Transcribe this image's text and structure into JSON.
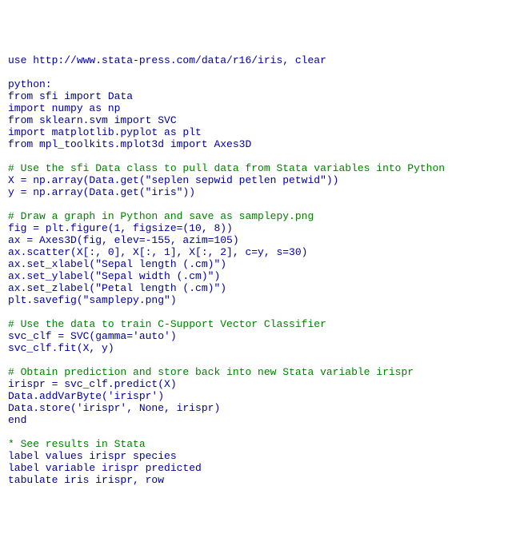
{
  "lines": [
    {
      "text": "use http://www.stata-press.com/data/r16/iris, clear",
      "class": "stata-cmd"
    },
    {
      "text": "",
      "class": ""
    },
    {
      "text": "python:",
      "class": "stata-cmd"
    },
    {
      "text": "from sfi import Data",
      "class": "python-code"
    },
    {
      "text": "import numpy as np",
      "class": "python-code"
    },
    {
      "text": "from sklearn.svm import SVC",
      "class": "python-code"
    },
    {
      "text": "import matplotlib.pyplot as plt",
      "class": "python-code"
    },
    {
      "text": "from mpl_toolkits.mplot3d import Axes3D",
      "class": "python-code"
    },
    {
      "text": "",
      "class": ""
    },
    {
      "text": "# Use the sfi Data class to pull data from Stata variables into Python",
      "class": "comment"
    },
    {
      "text": "X = np.array(Data.get(\"seplen sepwid petlen petwid\"))",
      "class": "python-code"
    },
    {
      "text": "y = np.array(Data.get(\"iris\"))",
      "class": "python-code"
    },
    {
      "text": "",
      "class": ""
    },
    {
      "text": "# Draw a graph in Python and save as samplepy.png",
      "class": "comment"
    },
    {
      "text": "fig = plt.figure(1, figsize=(10, 8))",
      "class": "python-code"
    },
    {
      "text": "ax = Axes3D(fig, elev=-155, azim=105)",
      "class": "python-code"
    },
    {
      "text": "ax.scatter(X[:, 0], X[:, 1], X[:, 2], c=y, s=30)",
      "class": "python-code"
    },
    {
      "text": "ax.set_xlabel(\"Sepal length (.cm)\")",
      "class": "python-code"
    },
    {
      "text": "ax.set_ylabel(\"Sepal width (.cm)\")",
      "class": "python-code"
    },
    {
      "text": "ax.set_zlabel(\"Petal length (.cm)\")",
      "class": "python-code"
    },
    {
      "text": "plt.savefig(\"samplepy.png\")",
      "class": "python-code"
    },
    {
      "text": "",
      "class": ""
    },
    {
      "text": "# Use the data to train C-Support Vector Classifier",
      "class": "comment"
    },
    {
      "text": "svc_clf = SVC(gamma='auto')",
      "class": "python-code"
    },
    {
      "text": "svc_clf.fit(X, y)",
      "class": "python-code"
    },
    {
      "text": "",
      "class": ""
    },
    {
      "text": "# Obtain prediction and store back into new Stata variable irispr",
      "class": "comment"
    },
    {
      "text": "irispr = svc_clf.predict(X)",
      "class": "python-code"
    },
    {
      "text": "Data.addVarByte('irispr')",
      "class": "python-code"
    },
    {
      "text": "Data.store('irispr', None, irispr)",
      "class": "python-code"
    },
    {
      "text": "end",
      "class": "stata-cmd"
    },
    {
      "text": "",
      "class": ""
    },
    {
      "text": "* See results in Stata",
      "class": "comment"
    },
    {
      "text": "label values irispr species",
      "class": "stata-cmd"
    },
    {
      "text": "label variable irispr predicted",
      "class": "stata-cmd"
    },
    {
      "text": "tabulate iris irispr, row",
      "class": "stata-cmd"
    }
  ]
}
